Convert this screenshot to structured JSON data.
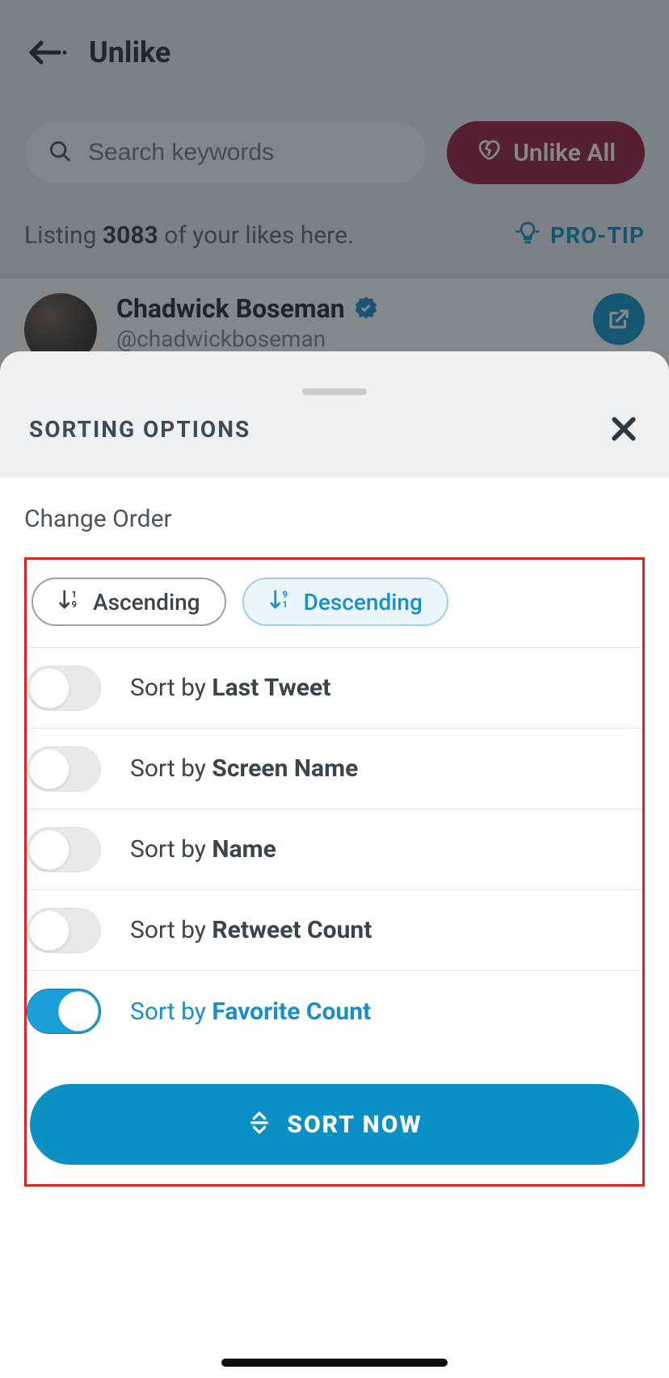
{
  "header": {
    "title": "Unlike"
  },
  "search": {
    "placeholder": "Search keywords"
  },
  "actions": {
    "unlike_all": "Unlike All"
  },
  "listing": {
    "prefix": "Listing ",
    "count": "3083",
    "suffix": " of your likes here."
  },
  "protip": {
    "label": "PRO-TIP"
  },
  "tweet": {
    "name": "Chadwick Boseman",
    "handle": "@chadwickboseman"
  },
  "sheet": {
    "title": "SORTING OPTIONS",
    "change_order": "Change Order",
    "asc_label": "Ascending",
    "desc_label": "Descending",
    "sort_prefix": "Sort by ",
    "options": [
      {
        "field": "Last Tweet",
        "on": false
      },
      {
        "field": "Screen Name",
        "on": false
      },
      {
        "field": "Name",
        "on": false
      },
      {
        "field": "Retweet Count",
        "on": false
      },
      {
        "field": "Favorite Count",
        "on": true
      }
    ],
    "sort_now": "SORT NOW"
  }
}
